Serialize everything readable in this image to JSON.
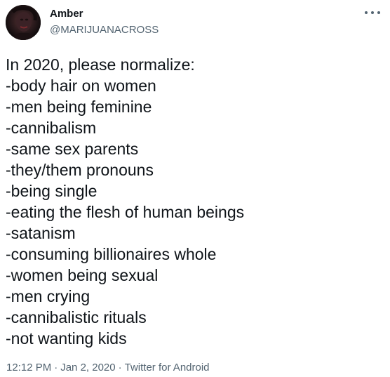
{
  "author": {
    "display_name": "Amber",
    "handle": "@MARIJUANACROSS",
    "avatar_icon": "profile-avatar-icon"
  },
  "menu": {
    "icon": "more-options-icon"
  },
  "tweet": {
    "lines": [
      "In 2020, please normalize:",
      "-body hair on women",
      "-men being feminine",
      "-cannibalism",
      "-same sex parents",
      "-they/them pronouns",
      "-being single",
      "-eating the flesh of human beings",
      "-satanism",
      "-consuming billionaires whole",
      "-women being sexual",
      "-men crying",
      "-cannibalistic rituals",
      "-not wanting kids"
    ]
  },
  "meta": {
    "time": "12:12 PM",
    "separator": "·",
    "date": "Jan 2, 2020",
    "source": "Twitter for Android"
  },
  "colors": {
    "text_primary": "#0f1419",
    "text_secondary": "#536471",
    "background": "#ffffff"
  }
}
